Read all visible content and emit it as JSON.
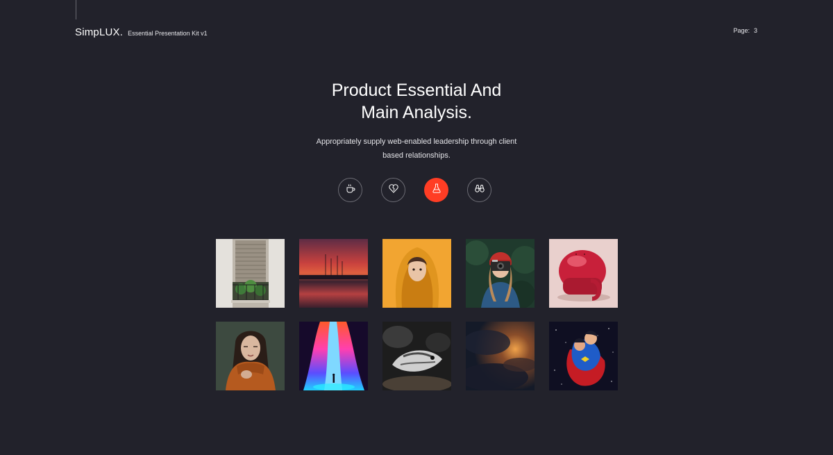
{
  "header": {
    "brand_name": "SimpLUX.",
    "brand_subtitle": "Essential Presentation Kit v1",
    "page_label": "Page:",
    "page_number": "3"
  },
  "hero": {
    "title_line1": "Product Essential And",
    "title_line2": "Main Analysis.",
    "desc_line1": "Appropriately supply web-enabled leadership through client",
    "desc_line2": "based relationships."
  },
  "icons": [
    {
      "name": "coffee-cup-icon",
      "active": false
    },
    {
      "name": "broken-heart-icon",
      "active": false
    },
    {
      "name": "flask-icon",
      "active": true
    },
    {
      "name": "binoculars-icon",
      "active": false
    }
  ],
  "colors": {
    "background": "#22222b",
    "accent": "#ff3d24",
    "icon_border": "#6c6c74"
  },
  "gallery": [
    {
      "name": "window-plants-photo"
    },
    {
      "name": "sunset-harbor-photo"
    },
    {
      "name": "yellow-hood-portrait-photo"
    },
    {
      "name": "camera-girl-photo"
    },
    {
      "name": "red-toy-photo"
    },
    {
      "name": "woman-sweater-portrait-photo"
    },
    {
      "name": "neon-ice-cave-photo"
    },
    {
      "name": "fish-sculpture-photo"
    },
    {
      "name": "stormy-sky-photo"
    },
    {
      "name": "superman-comic-photo"
    }
  ]
}
